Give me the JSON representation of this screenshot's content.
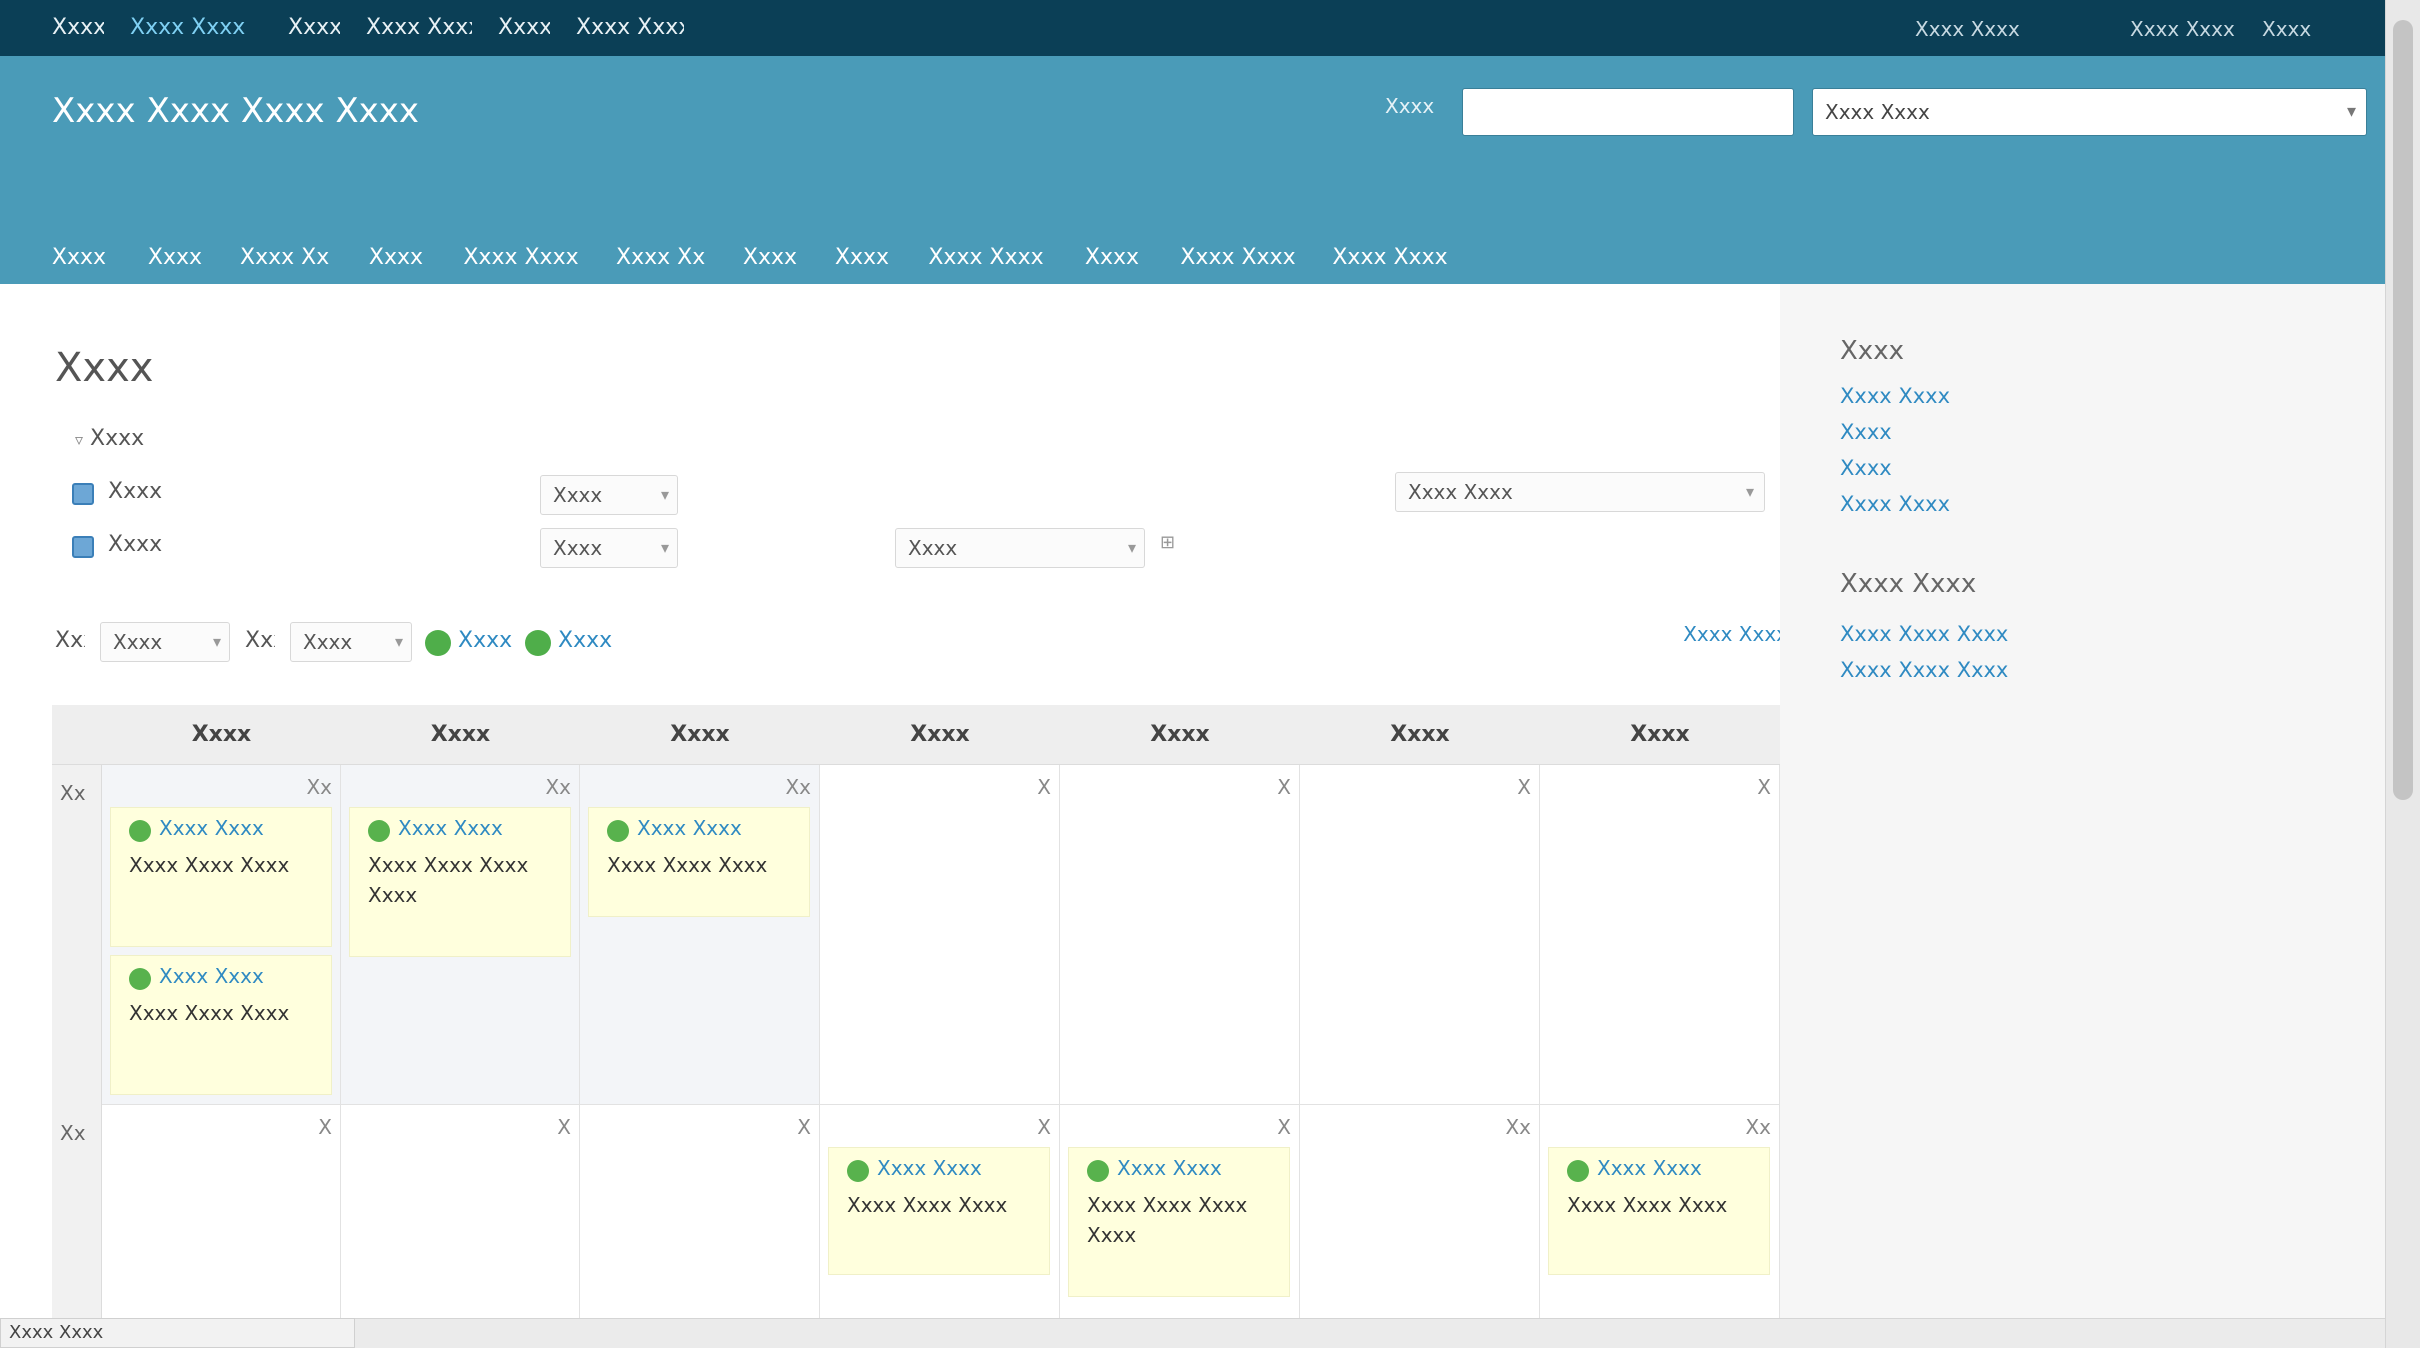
{
  "top_nav": {
    "left": [
      "Xxxx",
      "Xxxx Xxxx",
      "Xxxx",
      "Xxxx Xxxx",
      "Xxxx",
      "Xxxx Xxxx"
    ],
    "right": [
      "Xxxx Xxxx",
      "Xxxx Xxxx",
      "Xxxx"
    ]
  },
  "header": {
    "project_title": "Xxxx Xxxx Xxxx Xxxx",
    "search_label": "Xxxx",
    "search_placeholder": "",
    "project_select": "Xxxx Xxxx"
  },
  "main_tabs": [
    "Xxxx",
    "Xxxx",
    "Xxxx Xxxx",
    "Xxxx",
    "Xxxx Xxxx",
    "Xxxx Xxxx",
    "Xxxx",
    "Xxxx",
    "Xxxx Xxxx",
    "Xxxx",
    "Xxxx Xxxx",
    "Xxxx Xxxx"
  ],
  "page": {
    "title": "Xxxx",
    "filter_toggle": "Xxxx"
  },
  "filters": [
    {
      "name": "Xxxx",
      "operator": "Xxxx",
      "value": ""
    },
    {
      "name": "Xxxx",
      "operator": "Xxxx",
      "value": "Xxxx"
    }
  ],
  "add_filter_label": "Xxxx Xxxx",
  "period": {
    "label_month": "Xxxx",
    "month": "Xxxx",
    "label_year": "Xxxx",
    "year": "Xxxx",
    "apply": "Xxxx",
    "clear": "Xxxx"
  },
  "calendar_nav": "Xxxx Xxxx",
  "weekdays": [
    "Xxxx",
    "Xxxx",
    "Xxxx",
    "Xxxx",
    "Xxxx",
    "Xxxx",
    "Xxxx"
  ],
  "weeks": [
    {
      "week_label": "Xx",
      "days": [
        {
          "num": "Xx",
          "issues": [
            {
              "link": "Xxxx Xxxx",
              "subject": "Xxxx Xxxx Xxxx"
            },
            {
              "link": "Xxxx Xxxx",
              "subject": "Xxxx Xxxx Xxxx"
            }
          ]
        },
        {
          "num": "Xx",
          "issues": [
            {
              "link": "Xxxx Xxxx",
              "subject": "Xxxx Xxxx Xxxx Xxxx"
            }
          ]
        },
        {
          "num": "Xx",
          "issues": [
            {
              "link": "Xxxx Xxxx",
              "subject": "Xxxx Xxxx Xxxx"
            }
          ]
        },
        {
          "num": "X",
          "issues": []
        },
        {
          "num": "X",
          "issues": []
        },
        {
          "num": "X",
          "issues": []
        },
        {
          "num": "X",
          "issues": []
        }
      ]
    },
    {
      "week_label": "Xx",
      "days": [
        {
          "num": "X",
          "issues": []
        },
        {
          "num": "X",
          "issues": []
        },
        {
          "num": "X",
          "issues": []
        },
        {
          "num": "X",
          "issues": [
            {
              "link": "Xxxx Xxxx",
              "subject": "Xxxx Xxxx Xxxx"
            }
          ]
        },
        {
          "num": "X",
          "issues": [
            {
              "link": "Xxxx Xxxx",
              "subject": "Xxxx Xxxx Xxxx Xxxx"
            }
          ]
        },
        {
          "num": "Xx",
          "issues": []
        },
        {
          "num": "Xx",
          "issues": [
            {
              "link": "Xxxx Xxxx",
              "subject": "Xxxx Xxxx Xxxx"
            }
          ]
        }
      ]
    }
  ],
  "sidebar": {
    "sections": [
      {
        "title": "Xxxx",
        "links": [
          "Xxxx Xxxx",
          "Xxxx",
          "Xxxx",
          "Xxxx Xxxx"
        ]
      },
      {
        "title": "Xxxx Xxxx",
        "links": [
          "Xxxx Xxxx Xxxx",
          "Xxxx Xxxx Xxxx"
        ]
      }
    ]
  },
  "status_bar_url": "Xxxx Xxxx",
  "colors": {
    "top_bar": "#0b3f56",
    "header": "#4a9bb8",
    "link": "#2f8ac2",
    "issue_bg": "#ffffdd",
    "issue_icon": "#58b24d"
  },
  "icons": {
    "filter_checkbox": "checked-checkbox-icon",
    "apply": "check-icon",
    "clear": "reload-icon",
    "issue": "issue-status-icon"
  }
}
